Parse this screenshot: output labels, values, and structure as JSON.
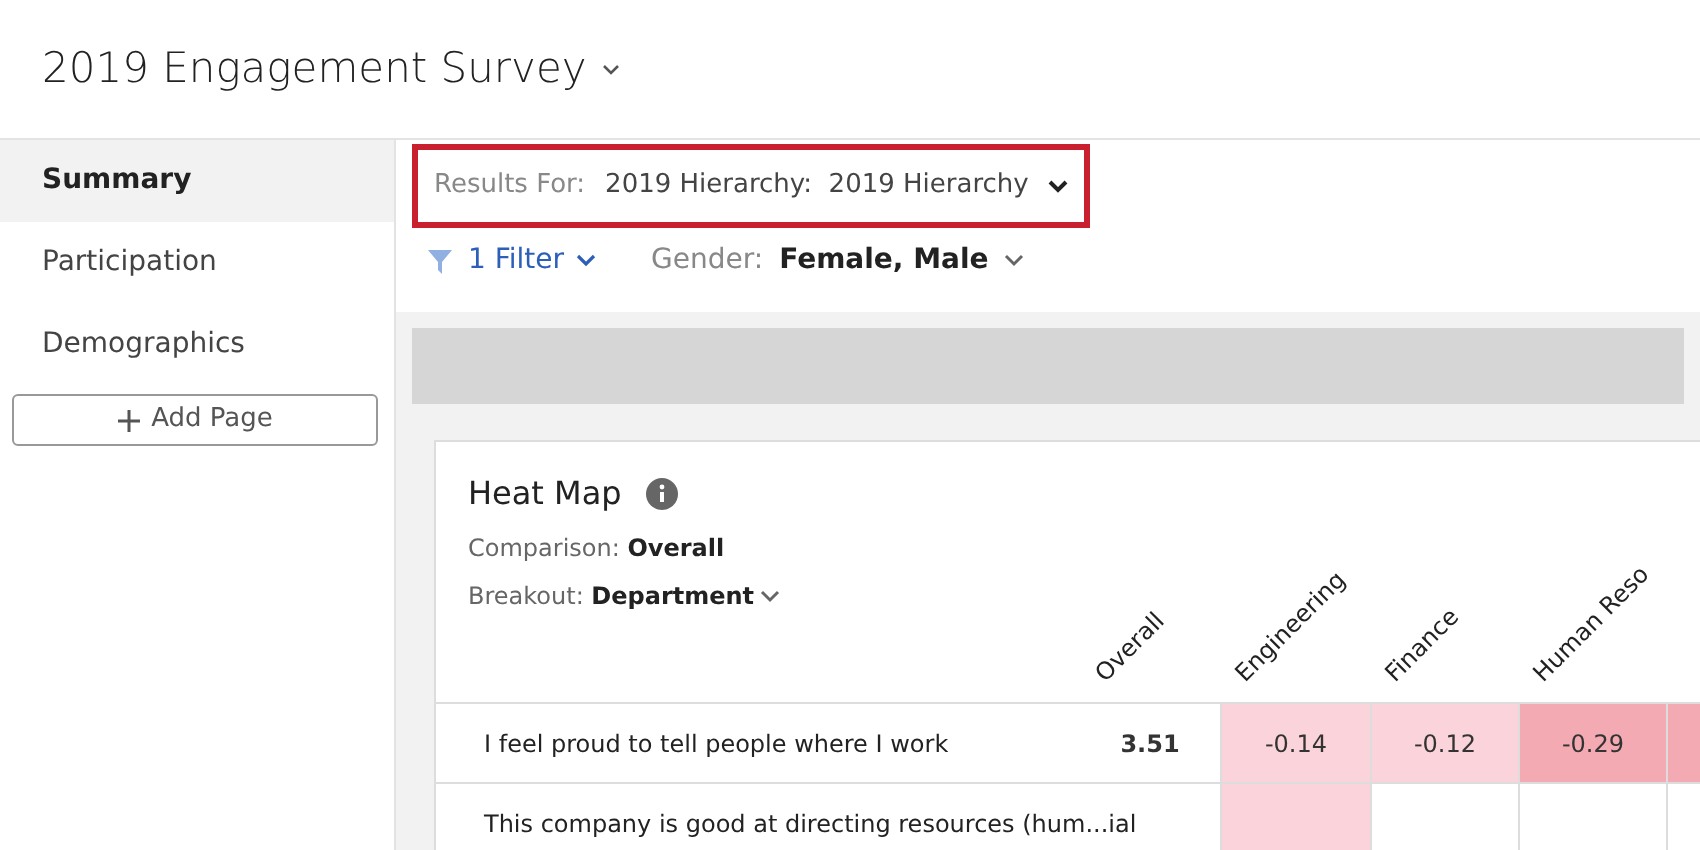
{
  "header": {
    "title": "2019 Engagement Survey"
  },
  "sidebar": {
    "items": [
      {
        "label": "Summary",
        "selected": true
      },
      {
        "label": "Participation",
        "selected": false
      },
      {
        "label": "Demographics",
        "selected": false
      }
    ],
    "add_button": "Add Page"
  },
  "results_for": {
    "label": "Results For:",
    "value": "2019 Hierarchy:  2019 Hierarchy"
  },
  "filters": {
    "count": "1 Filter",
    "field": "Gender:",
    "value": "Female, Male"
  },
  "heat_map": {
    "title": "Heat Map",
    "comparison_label": "Comparison:",
    "comparison": "Overall",
    "breakout_label": "Breakout:",
    "breakout": "Department",
    "columns": [
      "",
      "Overall",
      "Engineering",
      "Finance",
      "Human Reso"
    ],
    "rows": [
      {
        "cells": [
          {
            "kind": "question",
            "value": "I feel proud to tell people where I work"
          },
          {
            "kind": "score",
            "value": "3.51"
          },
          {
            "kind": "heat",
            "value": "-0.14",
            "color": "#fad4da"
          },
          {
            "kind": "heat",
            "value": "-0.12",
            "color": "#fad4da"
          },
          {
            "kind": "heat",
            "value": "-0.29",
            "color": "#f4aab3"
          },
          {
            "kind": "heat",
            "color": "#f4aab3"
          }
        ]
      },
      {
        "cells": [
          {
            "kind": "question",
            "value": "This company is good at directing resources (hum...ial"
          },
          {
            "kind": "score"
          },
          {
            "kind": "heat",
            "color": "#fad4da"
          },
          {
            "kind": "heat",
            "color": "#ffffff"
          },
          {
            "kind": "heat",
            "color": "#ffffff"
          },
          {
            "kind": "heat",
            "color": "#ffffff"
          }
        ]
      }
    ]
  }
}
